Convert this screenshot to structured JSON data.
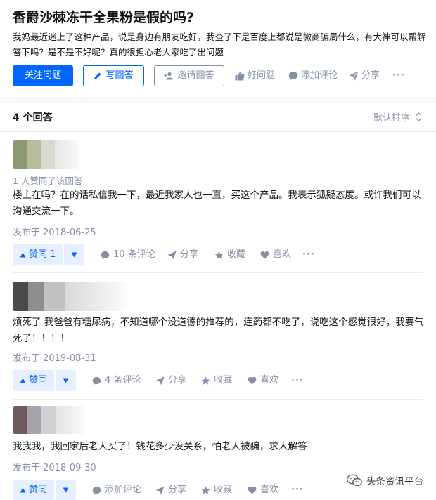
{
  "question": {
    "title": "香爵沙棘冻干全果粉是假的吗?",
    "detail": "我妈最近迷上了这种产品，说是身边有朋友吃好，我查了下是百度上都说是微商骗局什么，有大神可以帮解答下吗？是不是不好呢？真的很担心老人家吃了出问题",
    "follow_label": "关注问题",
    "write_label": "写回答",
    "invite_label": "邀请回答",
    "good_question_label": "好问题",
    "add_comment_label": "添加评论",
    "share_label": "分享",
    "more_label": "···"
  },
  "answers_header": {
    "count_label": "4 个回答",
    "sort_label": "默认排序"
  },
  "answers": [
    {
      "upvote_note": "1 人赞同了该回答",
      "body": "楼主在吗？在的话私信我一下，最近我家人也一直，买这个产品。我表示狐疑态度。或许我们可以沟通交流一下。",
      "date": "发布于 2018-06-25",
      "vote_label": "赞同 1",
      "comments_label": "10 条评论",
      "share_label": "分享",
      "favorite_label": "收藏",
      "like_label": "喜欢",
      "more_label": "···"
    },
    {
      "body": "烦死了 我爸爸有糖尿病，不知道哪个没道德的推荐的，连药都不吃了，说吃这个感觉很好，我要气死了！！！！",
      "date": "发布于 2019-08-31",
      "vote_label": "赞同",
      "comments_label": "4 条评论",
      "share_label": "分享",
      "favorite_label": "收藏",
      "like_label": "喜欢",
      "more_label": "···"
    },
    {
      "body": "我我我，我回家后老人买了！钱花多少没关系，怕老人被骗，求人解答",
      "date": "发布于 2018-09-30",
      "vote_label": "赞同",
      "comments_label": "添加评论",
      "share_label": "分享",
      "favorite_label": "收藏",
      "like_label": "喜欢",
      "more_label": "···"
    }
  ],
  "watermark": {
    "label": "头条资讯平台"
  },
  "colors": {
    "accent": "#0066ff",
    "muted": "#8590a6",
    "vote_bg": "#e5efff"
  }
}
